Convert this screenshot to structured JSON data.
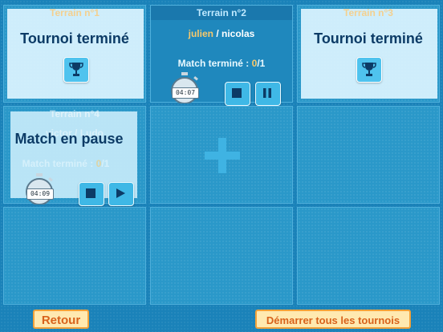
{
  "courts": [
    {
      "name": "Terrain n°1",
      "status": "Tournoi terminé"
    },
    {
      "name": "Terrain n°2",
      "player1": "julien",
      "separator": "/",
      "player2": "nicolas",
      "match_label": "Match terminé : ",
      "match_current": "0",
      "match_sep": "/",
      "match_total": "1",
      "timer": "04:07"
    },
    {
      "name": "Terrain n°3",
      "status": "Tournoi terminé"
    },
    {
      "name": "Terrain n°4",
      "player1": "victor",
      "separator": "/",
      "player2": "Ludo",
      "status": "Match en pause",
      "match_label": "Match terminé : ",
      "match_current": "0",
      "match_sep": "/",
      "match_total": "1",
      "timer": "04:09"
    }
  ],
  "add_court": {
    "icon": "plus-icon"
  },
  "footer": {
    "back_label": "Retour",
    "start_all_label": "Démarrer tous les tournois"
  },
  "colors": {
    "background": "#1a82b9",
    "header_text": "#bfe9ff",
    "title_text": "#0c3b66",
    "accent_orange": "#f7c86b",
    "button_text": "#d8621b"
  }
}
